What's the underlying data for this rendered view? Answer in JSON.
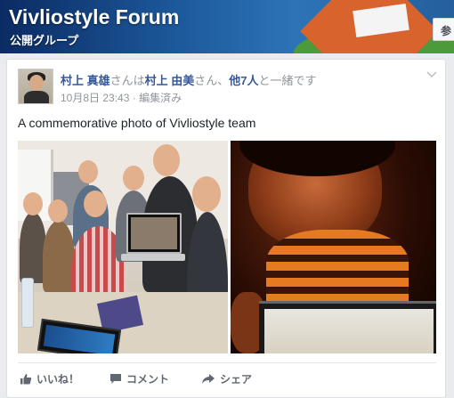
{
  "group": {
    "name": "Vivliostyle Forum",
    "type": "公開グループ",
    "join_button": "参"
  },
  "post": {
    "author": "村上 真雄",
    "with_prefix": "さんは",
    "tagged_person": "村上 由美",
    "tagged_suffix": "さん、",
    "others": "他7人",
    "with_suffix": "と一緒です",
    "date": "10月8日 23:43",
    "separator": " · ",
    "edited": "編集済み",
    "text": "A commemorative photo of Vivliostyle team"
  },
  "actions": {
    "like": "いいね！",
    "comment": "コメント",
    "share": "シェア"
  }
}
